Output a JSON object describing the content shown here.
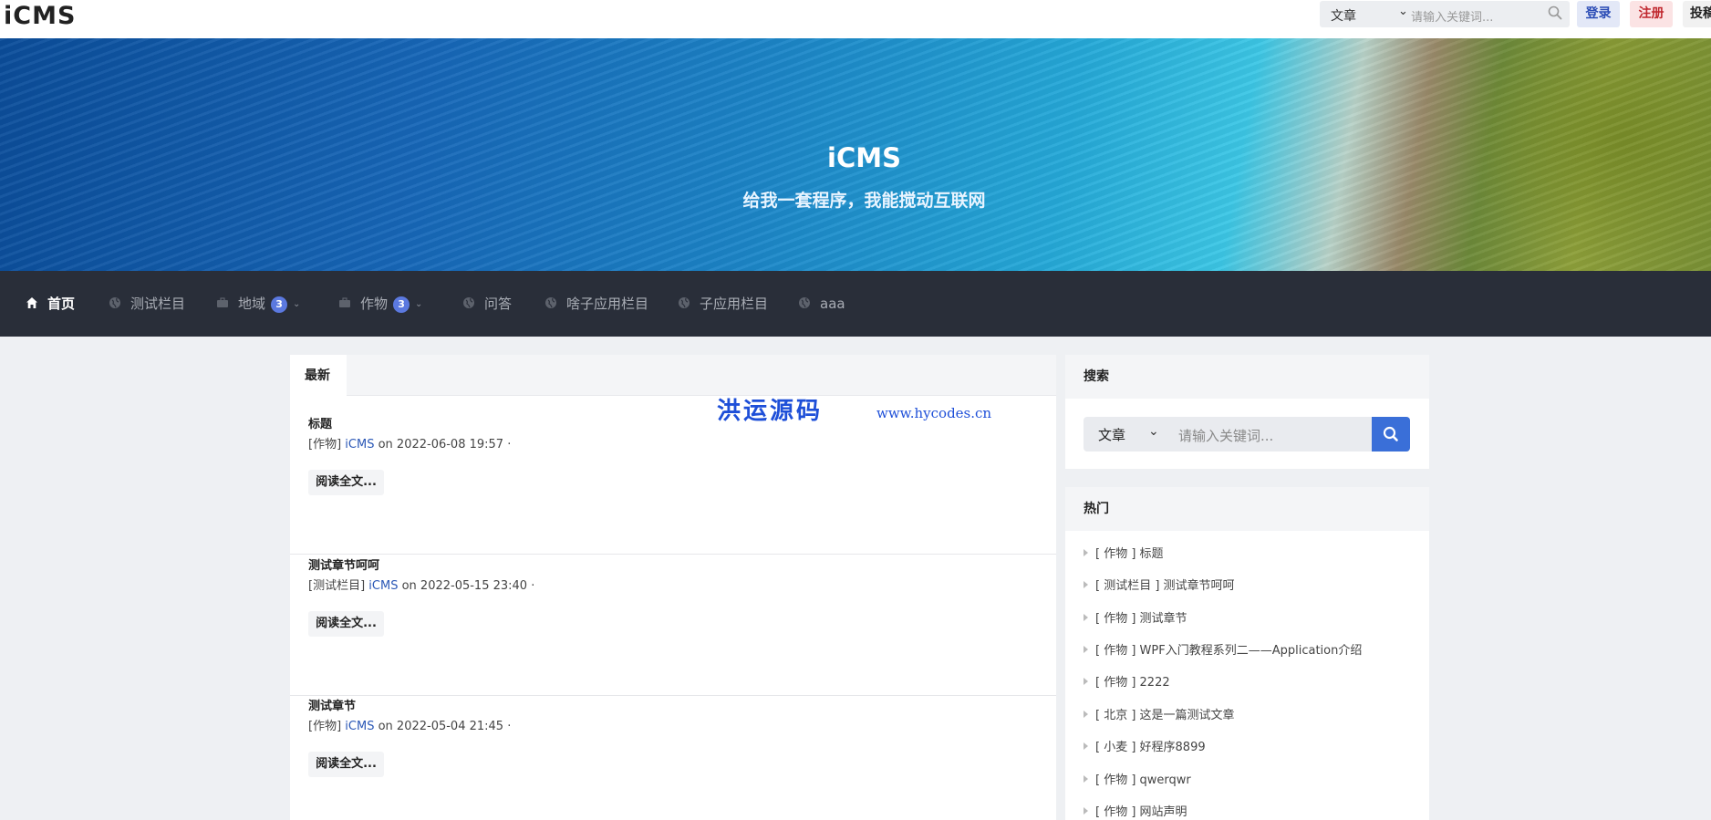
{
  "topbar": {
    "logo": "iCMS",
    "search_select": "文章",
    "search_placeholder": "请输入关键词...",
    "login": "登录",
    "register": "注册",
    "post": "投稿"
  },
  "banner": {
    "title": "iCMS",
    "subtitle": "给我一套程序，我能搅动互联网"
  },
  "nav": {
    "items": [
      {
        "label": "首页",
        "icon": "home-icon"
      },
      {
        "label": "测试栏目",
        "icon": "globe-icon"
      },
      {
        "label": "地域",
        "icon": "briefcase-icon",
        "badge": "3"
      },
      {
        "label": "作物",
        "icon": "briefcase-icon",
        "badge": "3"
      },
      {
        "label": "问答",
        "icon": "globe-icon"
      },
      {
        "label": "啥子应用栏目",
        "icon": "globe-icon"
      },
      {
        "label": "子应用栏目",
        "icon": "globe-icon"
      },
      {
        "label": "aaa",
        "icon": "globe-icon"
      }
    ]
  },
  "main": {
    "tab": "最新",
    "watermark": "洪运源码",
    "watermark_url": "www.hycodes.cn",
    "articles": [
      {
        "title": "标题",
        "category": "[作物]",
        "author": "iCMS",
        "date_text": " on 2022-06-08 19:57 ·",
        "read_more": "阅读全文..."
      },
      {
        "title": "测试章节呵呵",
        "category": "[测试栏目]",
        "author": "iCMS",
        "date_text": " on 2022-05-15 23:40 ·",
        "read_more": "阅读全文..."
      },
      {
        "title": "测试章节",
        "category": "[作物]",
        "author": "iCMS",
        "date_text": " on 2022-05-04 21:45 ·",
        "read_more": "阅读全文..."
      }
    ]
  },
  "sidebar": {
    "search_title": "搜索",
    "search_select": "文章",
    "search_placeholder": "请输入关键词...",
    "hot_title": "热门",
    "hot_items": [
      "[ 作物 ] 标题",
      "[ 测试栏目 ] 测试章节呵呵",
      "[ 作物 ] 测试章节",
      "[ 作物 ] WPF入门教程系列二——Application介绍",
      "[ 作物 ] 2222",
      "[ 北京 ] 这是一篇测试文章",
      "[ 小麦 ] 好程序8899",
      "[ 作物 ] qwerqwr",
      "[ 作物 ] 网站声明"
    ]
  },
  "colors": {
    "nav_bg": "#292e39",
    "accent": "#3a6fd8",
    "badge": "#5b79e0",
    "login": "#2a4bb5",
    "register": "#c0272d"
  }
}
